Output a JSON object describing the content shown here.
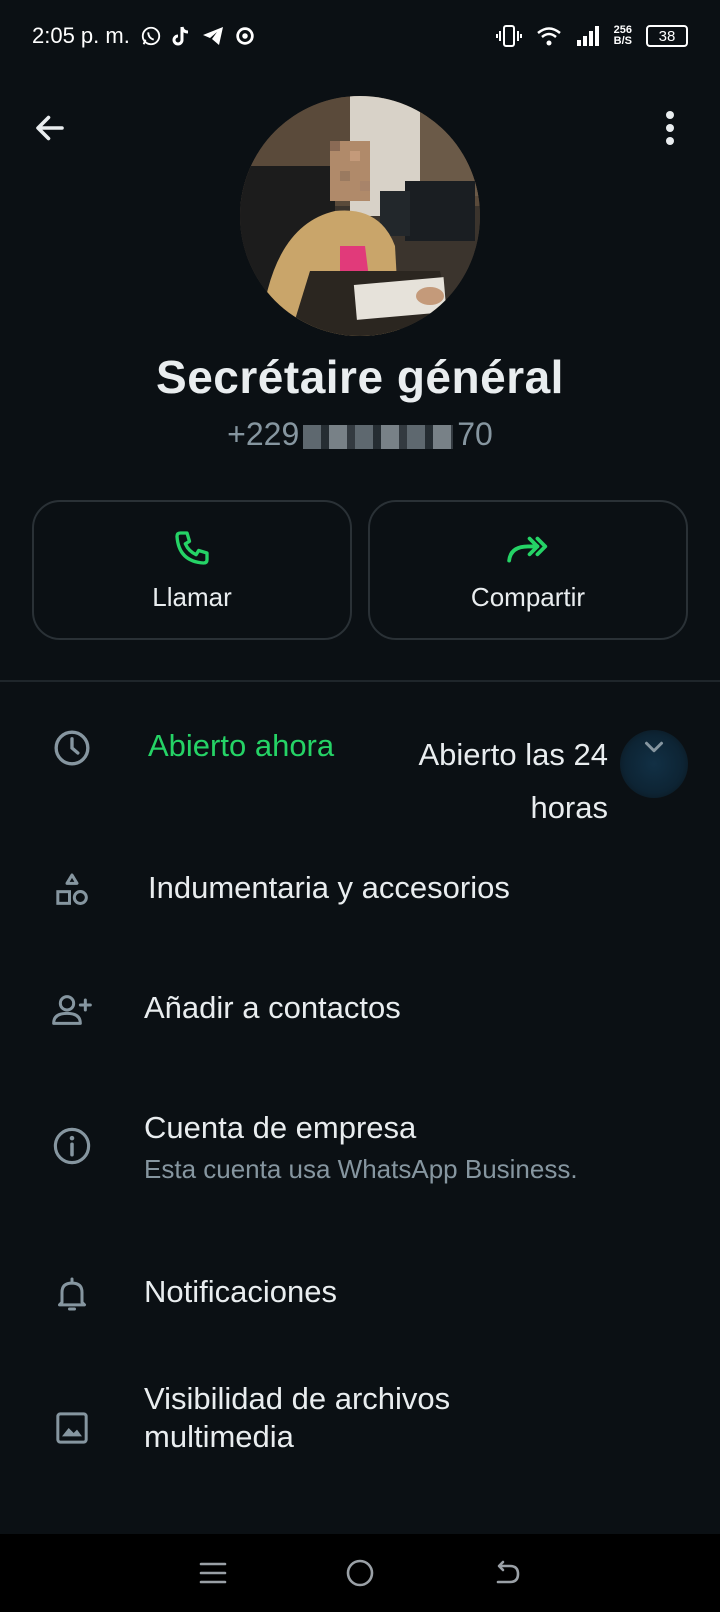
{
  "status_bar": {
    "time": "2:05 p. m.",
    "net_speed_value": "256",
    "net_speed_unit": "B/S",
    "battery": "38"
  },
  "header": {
    "contact_name": "Secrétaire général",
    "phone_prefix": "+229",
    "phone_suffix": "70"
  },
  "actions": {
    "call_label": "Llamar",
    "share_label": "Compartir"
  },
  "business_hours": {
    "status": "Abierto ahora",
    "hours_line1": "Abierto las 24",
    "hours_line2": "horas"
  },
  "info_rows": {
    "category": "Indumentaria y accesorios",
    "add_contact": "Añadir a contactos",
    "business_account_title": "Cuenta de empresa",
    "business_account_sub": "Esta cuenta usa WhatsApp Business.",
    "notifications": "Notificaciones",
    "media_visibility_line1": "Visibilidad de archivos",
    "media_visibility_line2": "multimedia"
  },
  "colors": {
    "accent_green": "#25d366",
    "background": "#0b1014",
    "secondary_text": "#8696a0"
  }
}
